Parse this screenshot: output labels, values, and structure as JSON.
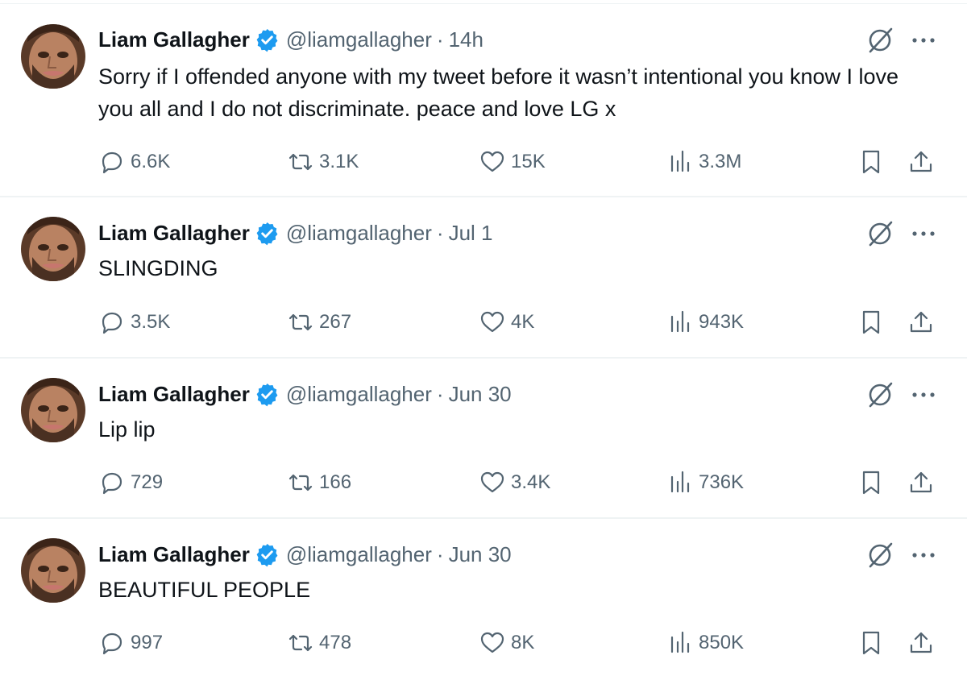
{
  "colors": {
    "text_primary": "#0f1419",
    "text_secondary": "#536471",
    "verified_blue": "#1d9bf0",
    "separator": "#eff3f4"
  },
  "icons": {
    "verified": "verified-badge-icon",
    "grok": "grok-icon",
    "more": "more-dots-icon",
    "reply": "reply-bubble-icon",
    "retweet": "retweet-icon",
    "like": "heart-icon",
    "views": "views-bars-icon",
    "bookmark": "bookmark-icon",
    "share": "share-upload-icon"
  },
  "tweets": [
    {
      "name": "Liam Gallagher",
      "handle": "@liamgallagher",
      "separator": "·",
      "time": "14h",
      "text": "Sorry if I offended anyone with my tweet before it wasn’t intentional you know I love you all and I do not discriminate. peace and love LG x",
      "replies": "6.6K",
      "retweets": "3.1K",
      "likes": "15K",
      "views": "3.3M"
    },
    {
      "name": "Liam Gallagher",
      "handle": "@liamgallagher",
      "separator": "·",
      "time": "Jul 1",
      "text": "SLINGDING",
      "replies": "3.5K",
      "retweets": "267",
      "likes": "4K",
      "views": "943K"
    },
    {
      "name": "Liam Gallagher",
      "handle": "@liamgallagher",
      "separator": "·",
      "time": "Jun 30",
      "text": "Lip lip",
      "replies": "729",
      "retweets": "166",
      "likes": "3.4K",
      "views": "736K"
    },
    {
      "name": "Liam Gallagher",
      "handle": "@liamgallagher",
      "separator": "·",
      "time": "Jun 30",
      "text": "BEAUTIFUL PEOPLE",
      "replies": "997",
      "retweets": "478",
      "likes": "8K",
      "views": "850K"
    }
  ]
}
